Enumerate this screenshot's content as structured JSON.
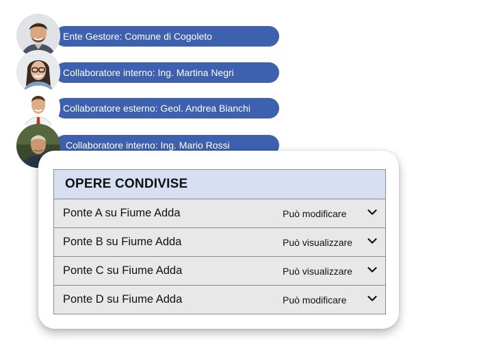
{
  "collaborators": [
    {
      "label": "Ente Gestore: Comune di Cogoleto",
      "avatar": "avatar-man-smiling-icon"
    },
    {
      "label": "Collaboratore interno: Ing. Martina Negri",
      "avatar": "avatar-woman-glasses-icon"
    },
    {
      "label": "Collaboratore esterno: Geol. Andrea Bianchi",
      "avatar": "avatar-man-shirt-icon"
    },
    {
      "label": "Collaboratore interno: Ing. Mario Rossi",
      "avatar": "avatar-older-man-icon"
    }
  ],
  "shared_works": {
    "title": "OPERE CONDIVISE",
    "rows": [
      {
        "name": "Ponte A su Fiume Adda",
        "permission": "Può modificare"
      },
      {
        "name": "Ponte B su Fiume Adda",
        "permission": "Può visualizzare"
      },
      {
        "name": "Ponte C su Fiume Adda",
        "permission": "Può visualizzare"
      },
      {
        "name": "Ponte D su Fiume Adda",
        "permission": "Può modificare"
      }
    ]
  },
  "colors": {
    "pill": "#3d61ae",
    "header": "#d6e0f2",
    "row": "#e8e8e8"
  }
}
